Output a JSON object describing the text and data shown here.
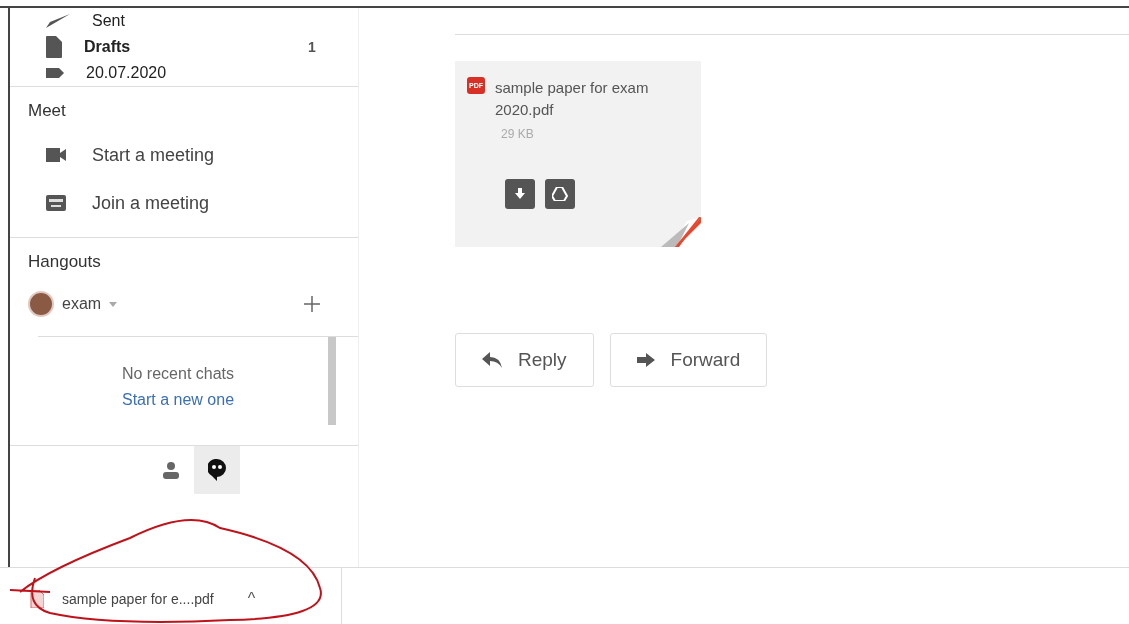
{
  "sidebar": {
    "folders": [
      {
        "label": "Sent",
        "bold": false,
        "kind": "sent"
      },
      {
        "label": "Drafts",
        "count": "1",
        "bold": true,
        "kind": "draft"
      },
      {
        "label": "20.07.2020",
        "bold": false,
        "kind": "label"
      }
    ],
    "meet": {
      "title": "Meet",
      "items": [
        {
          "label": "Start a meeting",
          "kind": "video"
        },
        {
          "label": "Join a meeting",
          "kind": "keyboard"
        }
      ]
    },
    "hangouts": {
      "title": "Hangouts",
      "user": "exam",
      "empty_text": "No recent chats",
      "link": "Start a new one",
      "tabs": [
        {
          "kind": "contacts",
          "selected": false
        },
        {
          "kind": "chat",
          "selected": true
        }
      ]
    }
  },
  "attachment": {
    "name": "sample paper for exam 2020.pdf",
    "size": "29 KB",
    "badge": "PDF"
  },
  "actions": [
    {
      "label": "Reply",
      "kind": "reply"
    },
    {
      "label": "Forward",
      "kind": "forward"
    }
  ],
  "download_bar": {
    "file": "sample paper for e....pdf",
    "caret": "^"
  }
}
